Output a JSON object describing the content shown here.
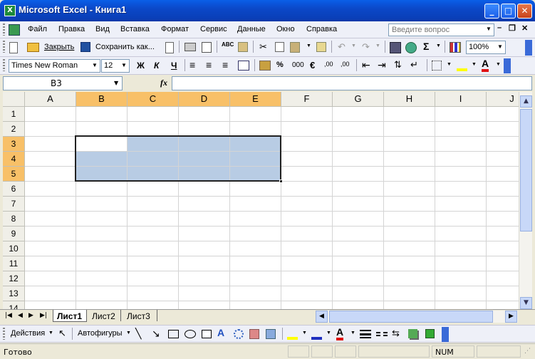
{
  "window": {
    "title": "Microsoft Excel - Книга1"
  },
  "menu": {
    "items": [
      "Файл",
      "Правка",
      "Вид",
      "Вставка",
      "Формат",
      "Сервис",
      "Данные",
      "Окно",
      "Справка"
    ],
    "help_placeholder": "Введите вопрос"
  },
  "toolbar": {
    "close_label": "Закрыть",
    "save_as_label": "Сохранить как...",
    "zoom": "100%"
  },
  "format": {
    "font_name": "Times New Roman",
    "font_size": "12",
    "bold": "Ж",
    "italic": "К",
    "underline": "Ч",
    "percent": "%",
    "thousands": "000",
    "euro": "€"
  },
  "formula": {
    "name_box": "B3",
    "fx": "fx"
  },
  "grid": {
    "columns": [
      "A",
      "B",
      "C",
      "D",
      "E",
      "F",
      "G",
      "H",
      "I",
      "J"
    ],
    "rows": [
      "1",
      "2",
      "3",
      "4",
      "5",
      "6",
      "7",
      "8",
      "9",
      "10",
      "11",
      "12",
      "13",
      "14"
    ],
    "selected_range": "B3:E5"
  },
  "sheets": {
    "tabs": [
      "Лист1",
      "Лист2",
      "Лист3"
    ],
    "active": "Лист1"
  },
  "drawing": {
    "actions_label": "Действия",
    "autoshapes_label": "Автофигуры"
  },
  "status": {
    "ready": "Готово",
    "num": "NUM"
  }
}
